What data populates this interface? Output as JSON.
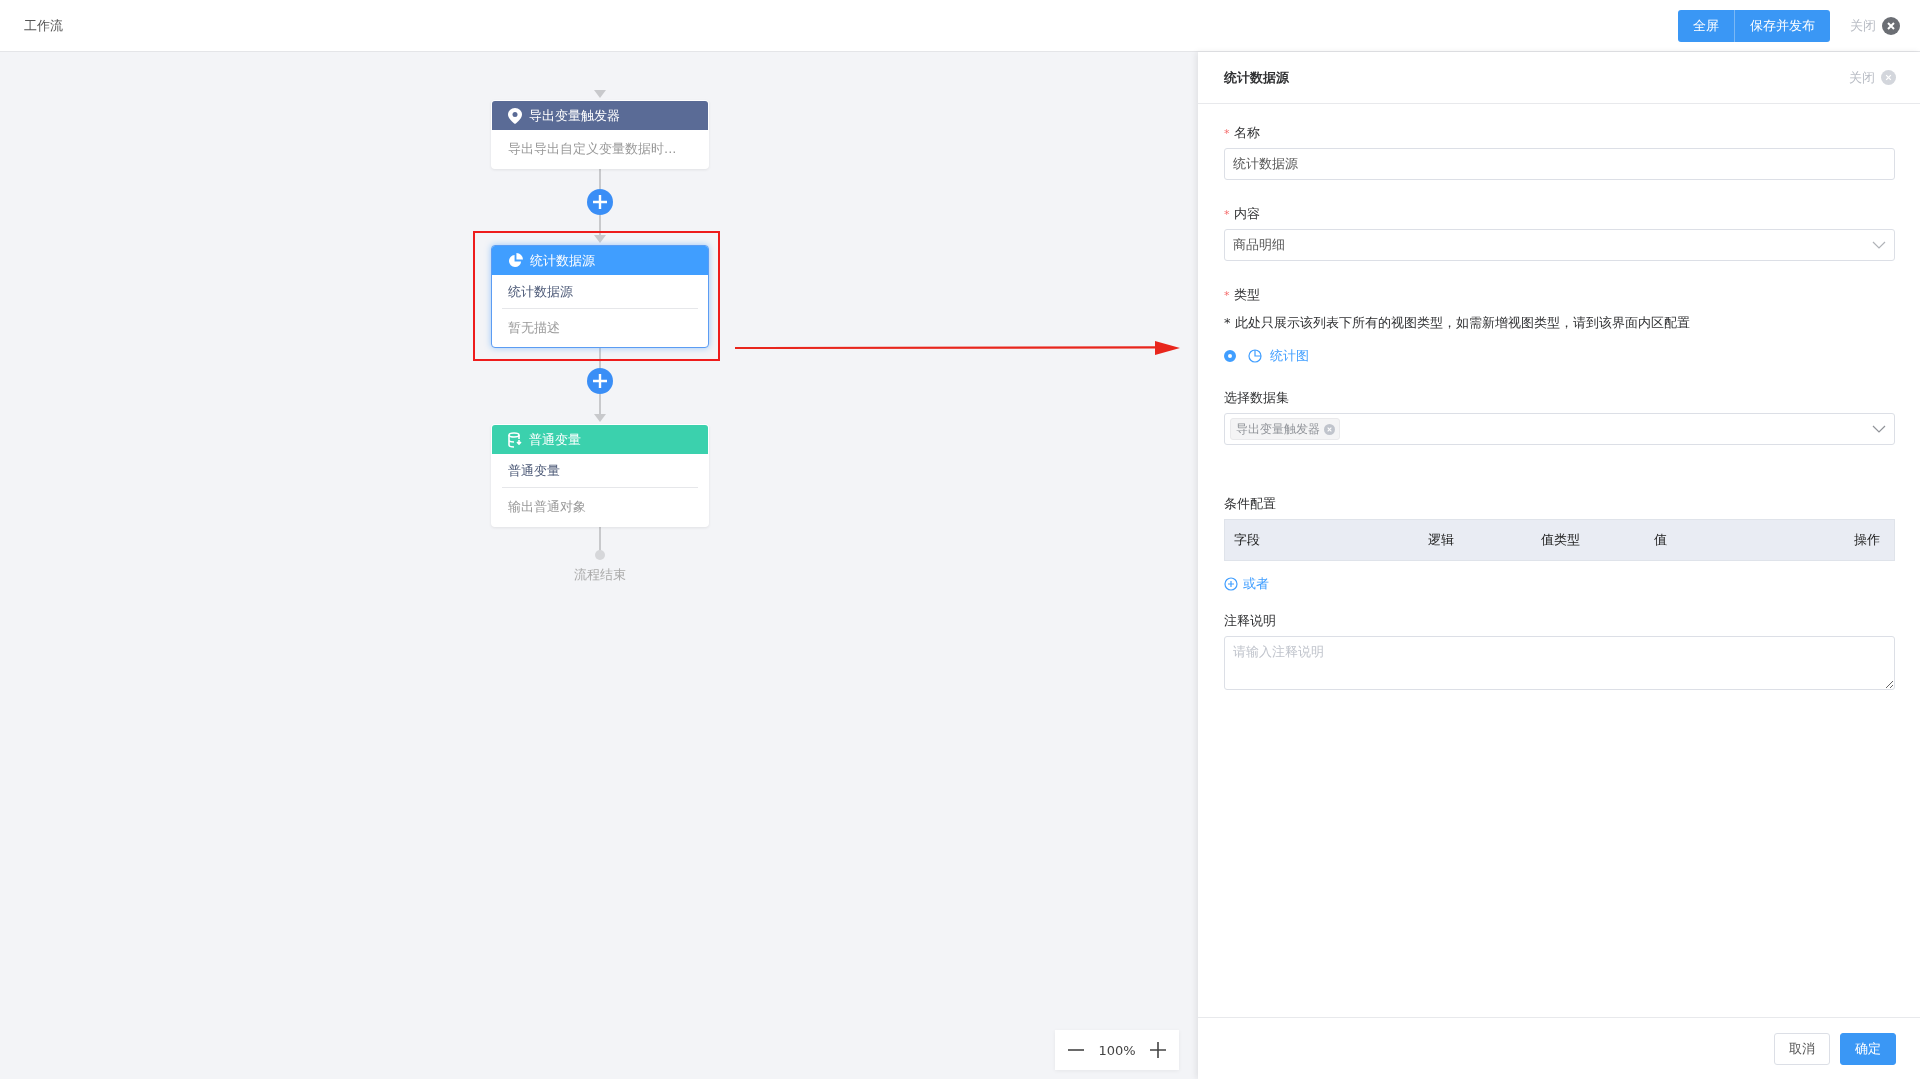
{
  "header": {
    "title": "工作流",
    "buttons": [
      "全屏",
      "保存并发布"
    ],
    "close": "关闭"
  },
  "flow": {
    "nodes": [
      {
        "kind": "trigger",
        "color": "#5a6b96",
        "title": "导出变量触发器",
        "description": "导出导出自定义变量数据时...",
        "selected": false
      },
      {
        "kind": "stat",
        "color": "#409eff",
        "title": "统计数据源",
        "name": "统计数据源",
        "description": "暂无描述",
        "selected": true
      },
      {
        "kind": "variable",
        "color": "#3bd1ad",
        "title": "普通变量",
        "name": "普通变量",
        "description": "输出普通对象",
        "selected": false
      }
    ],
    "end_label": "流程结束",
    "zoom": "100%"
  },
  "panel": {
    "title": "统计数据源",
    "close": "关闭",
    "name_field": {
      "label": "名称",
      "required_mark": "*",
      "value": "统计数据源"
    },
    "content_field": {
      "label": "内容",
      "required_mark": "*",
      "value": "商品明细"
    },
    "type_field": {
      "label": "类型",
      "required_mark": "*",
      "note": "* 此处只展示该列表下所有的视图类型，如需新增视图类型，请到该界面内区配置",
      "options": [
        {
          "label": "统计图",
          "selected": true
        }
      ]
    },
    "dataset_field": {
      "label": "选择数据集",
      "tags": [
        "导出变量触发器"
      ]
    },
    "conditions": {
      "label": "条件配置",
      "columns": [
        "字段",
        "逻辑",
        "值类型",
        "值",
        "操作"
      ],
      "add_link": "或者"
    },
    "remark_field": {
      "label": "注释说明",
      "placeholder": "请输入注释说明"
    },
    "buttons": {
      "cancel": "取消",
      "confirm": "确定"
    }
  }
}
